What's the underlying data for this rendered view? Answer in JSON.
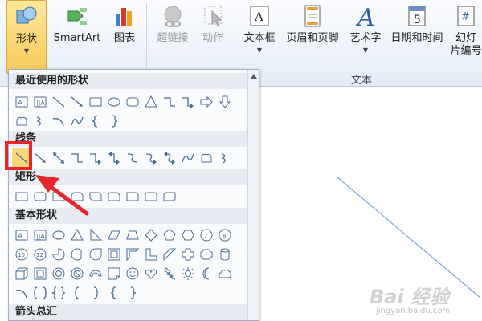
{
  "ribbon": {
    "buttons": [
      {
        "label": "形状",
        "icon": "shapes-icon"
      },
      {
        "label": "SmartArt",
        "icon": "smartart-icon"
      },
      {
        "label": "图表",
        "icon": "chart-icon"
      },
      {
        "label": "超链接",
        "icon": "hyperlink-icon"
      },
      {
        "label": "动作",
        "icon": "action-icon"
      },
      {
        "label": "文本框",
        "icon": "textbox-icon"
      },
      {
        "label": "页眉和页脚",
        "icon": "header-footer-icon"
      },
      {
        "label": "艺术字",
        "icon": "wordart-icon"
      },
      {
        "label": "日期和时间",
        "icon": "date-time-icon",
        "icon_text": "5"
      },
      {
        "label_line1": "幻灯",
        "label_line2": "片编号",
        "icon": "slide-number-icon",
        "icon_text": "#"
      }
    ],
    "group_text_label": "文本"
  },
  "panel": {
    "sections": [
      {
        "title": "最近使用的形状"
      },
      {
        "title": "线条"
      },
      {
        "title": "矩形"
      },
      {
        "title": "基本形状"
      },
      {
        "title": "箭头总汇"
      }
    ]
  },
  "watermark": {
    "main": "Bai 经验",
    "url": "jingyan.baidu.com"
  },
  "colors": {
    "highlight": "#e8262a",
    "shape_stroke": "#4a6a93",
    "doc_line": "#7aa6d6"
  }
}
